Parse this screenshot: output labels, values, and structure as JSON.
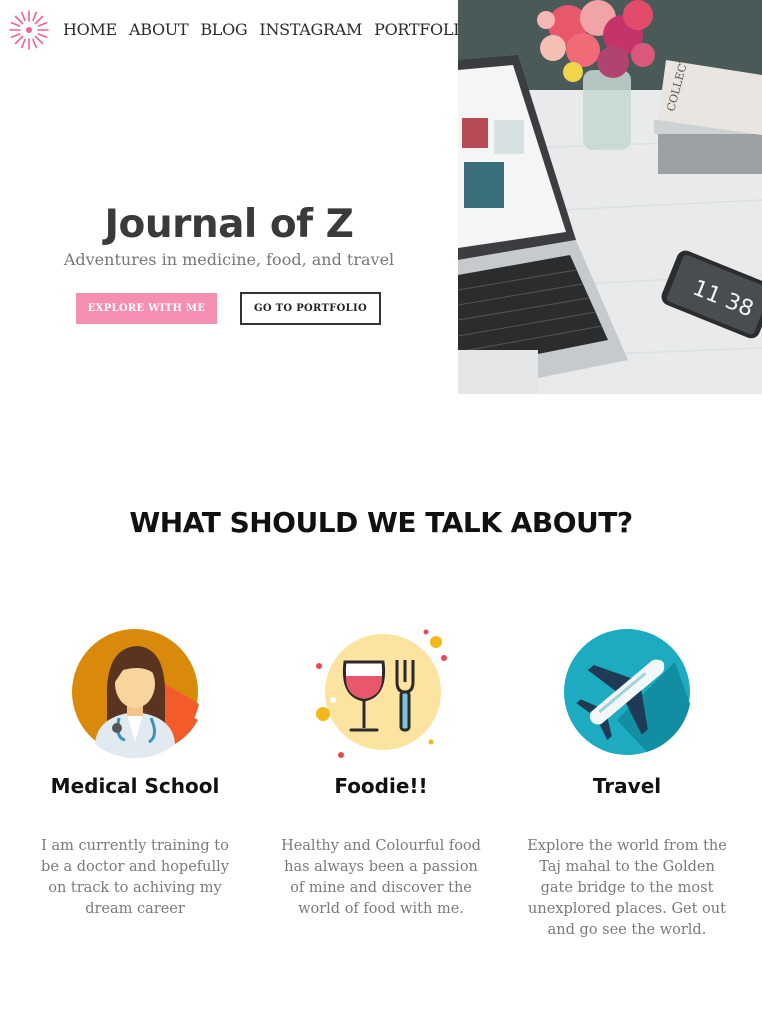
{
  "nav": {
    "items": [
      "HOME",
      "ABOUT",
      "BLOG",
      "INSTAGRAM",
      "PORTFOLIO"
    ]
  },
  "hero": {
    "title": "Journal of Z",
    "subtitle": "Adventures in medicine, food, and travel",
    "primary_button": "EXPLORE WITH ME",
    "secondary_button": "GO TO PORTFOLIO",
    "phone_time": "11 38"
  },
  "section": {
    "title": "WHAT SHOULD WE TALK ABOUT?"
  },
  "cards": [
    {
      "title": "Medical School",
      "body": "I am currently training to be a doctor and hopefully on track to achiving my dream career",
      "icon": "doctor-icon"
    },
    {
      "title": "Foodie!!",
      "body": "Healthy and Colourful food has always been a passion of mine and discover the world of food with me.",
      "icon": "wine-fork-icon"
    },
    {
      "title": "Travel",
      "body": "Explore the world from the Taj mahal to the Golden gate bridge to the most unexplored places. Get out and go see the world.",
      "icon": "airplane-icon"
    }
  ],
  "colors": {
    "accent_pink": "#f48fb1",
    "doctor_bg": "#d98a0a",
    "food_bg": "#fde3a0",
    "travel_bg": "#1cabc0"
  }
}
